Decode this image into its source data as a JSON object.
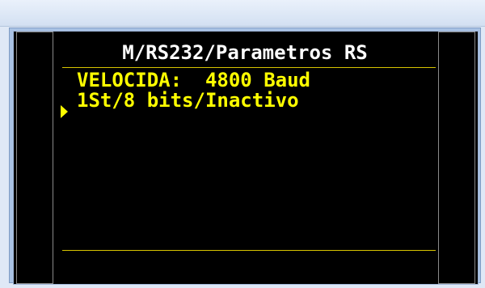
{
  "lcd": {
    "title": "M/RS232/Parametros RS",
    "lines": [
      "VELOCIDA:  4800 Baud",
      "1St/8 bits/Inactivo"
    ],
    "selected_index": 0
  },
  "colors": {
    "lcd_background": "#000000",
    "title_text": "#ffffff",
    "item_text": "#ffff00",
    "rule": "#d7c400",
    "frame": "#a9c2e4"
  },
  "icons": {
    "selection_cursor": "triangle-right-icon"
  }
}
